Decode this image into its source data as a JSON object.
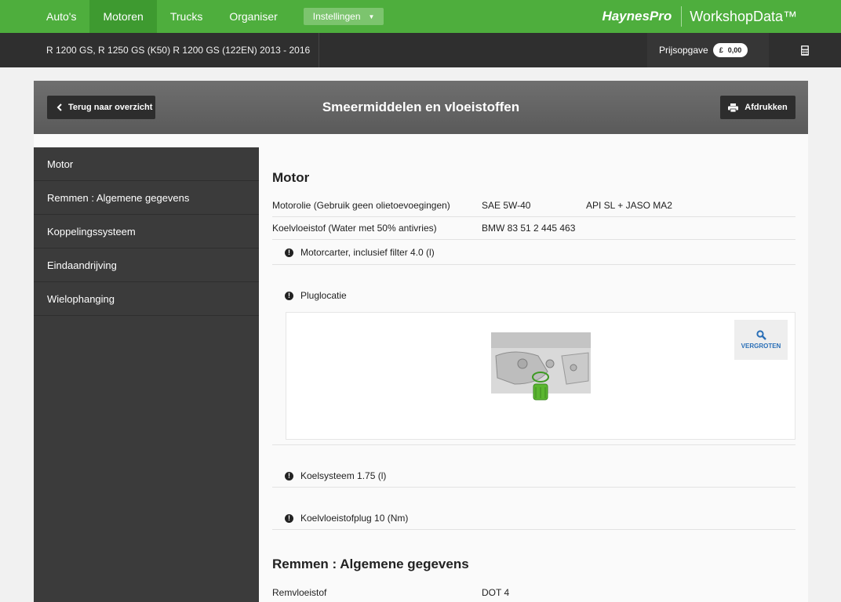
{
  "nav": {
    "tabs": [
      {
        "label": "Auto's",
        "active": false
      },
      {
        "label": "Motoren",
        "active": true
      },
      {
        "label": "Trucks",
        "active": false
      },
      {
        "label": "Organiser",
        "active": false
      }
    ],
    "settings_label": "Instellingen",
    "brand_primary": "HaynesPro",
    "brand_secondary": "WorkshopData™"
  },
  "vehicle": {
    "title": "R 1200 GS, R 1250 GS (K50) R 1200 GS (122EN) 2013 - 2016",
    "quote_label": "Prijsopgave",
    "quote_currency": "£",
    "quote_value": "0,00"
  },
  "panel": {
    "back_label": "Terug naar overzicht",
    "title": "Smeermiddelen en vloeistoffen",
    "print_label": "Afdrukken"
  },
  "sidebar": {
    "items": [
      {
        "label": "Motor"
      },
      {
        "label": "Remmen : Algemene gegevens"
      },
      {
        "label": "Koppelingssysteem"
      },
      {
        "label": "Eindaandrijving"
      },
      {
        "label": "Wielophanging"
      }
    ]
  },
  "content": {
    "motor": {
      "heading": "Motor",
      "rows": [
        {
          "name": "Motorolie (Gebruik geen olietoevoegingen)",
          "value": "SAE 5W-40",
          "spec": "API SL + JASO MA2"
        },
        {
          "name": "Koelvloeistof (Water met 50% antivries)",
          "value": "BMW 83 51 2 445 463",
          "spec": ""
        }
      ],
      "capacity_note": "Motorcarter, inclusief filter 4.0 (l)",
      "plug_note": "Pluglocatie",
      "zoom_label": "VERGROTEN",
      "cooling_note": "Koelsysteem 1.75 (l)",
      "coolant_plug_note": "Koelvloeistofplug 10 (Nm)"
    },
    "brakes": {
      "heading": "Remmen : Algemene gegevens",
      "rows": [
        {
          "name": "Remvloeistof",
          "value": "DOT 4",
          "spec": ""
        }
      ]
    }
  },
  "colors": {
    "brand_green": "#4eae3d",
    "active_tab": "#3e9a30",
    "dark_bar": "#2f2f2f",
    "sidebar_bg": "#3b3b3b",
    "link_blue": "#2a6fb7"
  }
}
